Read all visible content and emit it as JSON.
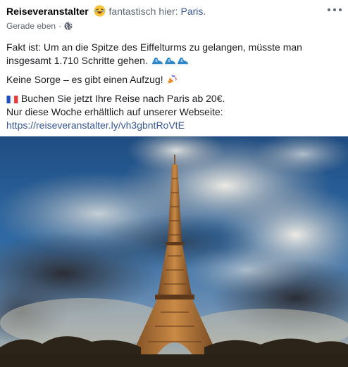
{
  "header": {
    "page_name": "Reiseveranstalter",
    "feeling_emoji": "laughing-emoji",
    "feeling_text": "fantastisch hier:",
    "place": "Paris",
    "period": ".",
    "timestamp": "Gerade eben",
    "separator": "·",
    "audience_icon": "globe-icon",
    "more_icon": "more-options-icon"
  },
  "post": {
    "line1": "Fakt ist: Um an die Spitze des Eiffelturms zu gelangen, müsste man insgesamt 1.710 Schritte gehen.",
    "line1_emoji": "sneaker-emoji ×3",
    "line2": "Keine Sorge – es gibt einen Aufzug!",
    "line2_emoji": "party-popper-emoji",
    "line3_flag": "french-flag-emoji",
    "line3": "Buchen Sie jetzt Ihre Reise nach Paris ab 20€.",
    "line4": "Nur diese Woche erhältlich auf unserer Webseite:",
    "link": "https://reiseveranstalter.ly/vh3gbntRoVtE"
  },
  "image": {
    "subject": "eiffel-tower-photo"
  },
  "colors": {
    "link": "#385898",
    "secondary_text": "#606770",
    "text": "#1c1e21"
  }
}
